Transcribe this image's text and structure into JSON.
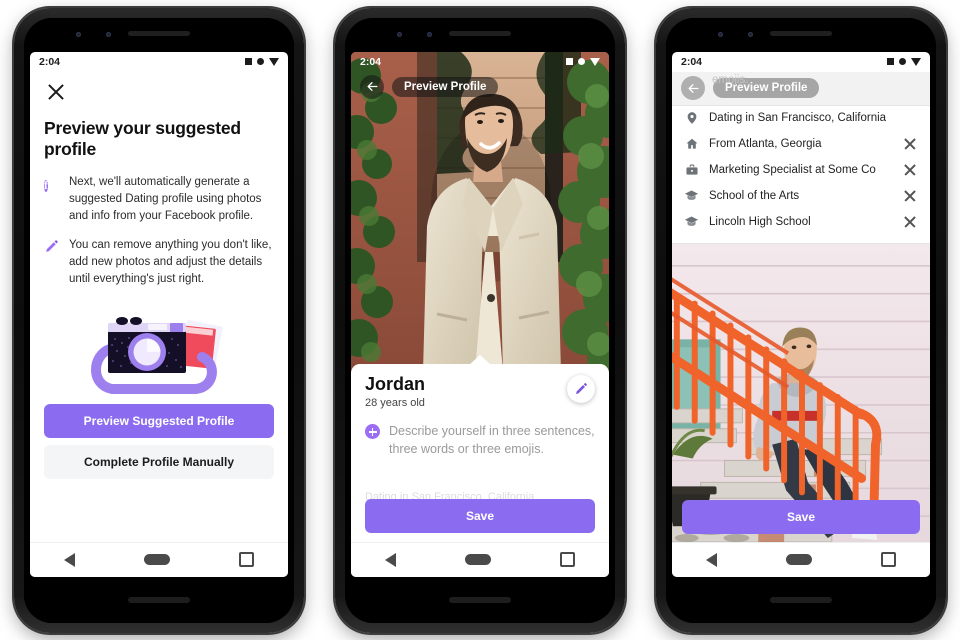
{
  "colors": {
    "accent_purple": "#8b6cf0",
    "icon_purple": "#9b6ef3",
    "secondary_button_bg": "#f4f5f7",
    "prompt_text_gray": "#9a9a9a"
  },
  "phones": [
    {
      "id": "phone-onboarding",
      "status_bar": {
        "time": "2:04",
        "icons": [
          "square-icon",
          "circle-icon",
          "triangle-icon"
        ]
      },
      "screen": {
        "close_icon": "close-icon",
        "title": "Preview your suggested profile",
        "bullets": [
          {
            "icon": "facebook-icon",
            "glyph": "f",
            "text": "Next, we'll automatically generate a suggested Dating profile using photos and info from your Facebook profile."
          },
          {
            "icon": "pencil-icon",
            "glyph": "",
            "text": "You can remove anything you don't like, add new photos and adjust the details until everything's just right."
          }
        ],
        "illustration": "camera-with-photos-illustration",
        "primary_button": "Preview Suggested Profile",
        "secondary_button": "Complete Profile Manually"
      },
      "nav_bar": [
        "back-triangle-icon",
        "home-pill-icon",
        "recents-square-icon"
      ]
    },
    {
      "id": "phone-preview-profile",
      "status_bar": {
        "time": "2:04",
        "icons": [
          "square-icon",
          "circle-icon",
          "triangle-icon"
        ]
      },
      "screen": {
        "back_icon": "back-arrow-icon",
        "header_title": "Preview Profile",
        "photo": "man-in-cream-suit-brick-wall-foliage",
        "name": "Jordan",
        "age": "28 years old",
        "edit_icon": "pencil-icon",
        "prompt_icon": "plus-icon",
        "prompt_text": "Describe yourself in three sentences, three words or three emojis.",
        "ghost_text": "Dating in San Francisco, California",
        "save_button": "Save"
      },
      "nav_bar": [
        "back-triangle-icon",
        "home-pill-icon",
        "recents-square-icon"
      ]
    },
    {
      "id": "phone-edit-details",
      "status_bar": {
        "time": "2:04",
        "icons": [
          "square-icon",
          "circle-icon",
          "triangle-icon"
        ]
      },
      "screen": {
        "back_icon": "back-arrow-icon",
        "header_title": "Preview Profile",
        "ghost_text": "emojis.",
        "attributes": [
          {
            "icon": "location-pin-icon",
            "label": "Dating in San Francisco, California",
            "removable": false
          },
          {
            "icon": "home-icon",
            "label": "From Atlanta, Georgia",
            "removable": true
          },
          {
            "icon": "briefcase-icon",
            "label": "Marketing Specialist at Some Co",
            "removable": true
          },
          {
            "icon": "graduation-cap-icon",
            "label": "School of the Arts",
            "removable": true
          },
          {
            "icon": "graduation-cap-icon",
            "label": "Lincoln High School",
            "removable": true
          }
        ],
        "photo": "man-on-orange-staircase-pink-house",
        "save_button": "Save"
      },
      "nav_bar": [
        "back-triangle-icon",
        "home-pill-icon",
        "recents-square-icon"
      ]
    }
  ]
}
